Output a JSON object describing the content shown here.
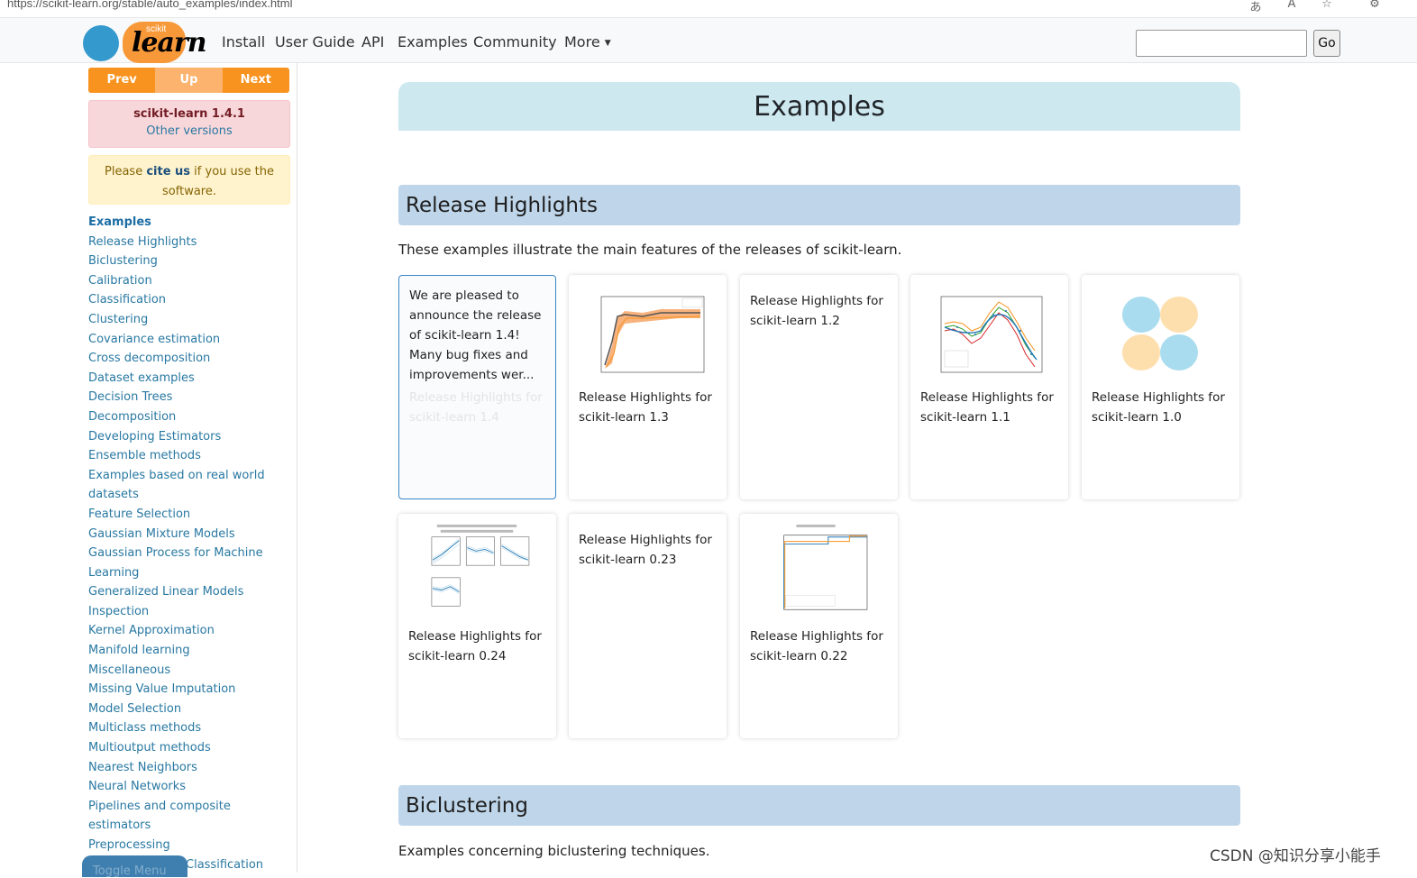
{
  "browser": {
    "url": "https://scikit-learn.org/stable/auto_examples/index.html",
    "icons": [
      "translate-icon",
      "read-aloud-icon",
      "favorite-icon",
      "extensions-icon"
    ]
  },
  "navbar": {
    "logo_small": "scikit",
    "logo_big": "learn",
    "links": [
      "Install",
      "User Guide",
      "API",
      "Examples",
      "Community",
      "More"
    ],
    "search_value": "",
    "go_label": "Go"
  },
  "sidebar": {
    "prev": "Prev",
    "up": "Up",
    "next": "Next",
    "version": "scikit-learn 1.4.1",
    "other_versions": "Other versions",
    "cite_pre": "Please ",
    "cite_link": "cite us",
    "cite_post": " if you use the software.",
    "toc": [
      "Examples",
      "Release Highlights",
      "Biclustering",
      "Calibration",
      "Classification",
      "Clustering",
      "Covariance estimation",
      "Cross decomposition",
      "Dataset examples",
      "Decision Trees",
      "Decomposition",
      "Developing Estimators",
      "Ensemble methods",
      "Examples based on real world",
      "datasets",
      "Feature Selection",
      "Gaussian Mixture Models",
      "Gaussian Process for Machine",
      "Learning",
      "Generalized Linear Models",
      "Inspection",
      "Kernel Approximation",
      "Manifold learning",
      "Miscellaneous",
      "Missing Value Imputation",
      "Model Selection",
      "Multiclass methods",
      "Multioutput methods",
      "Nearest Neighbors",
      "Neural Networks",
      "Pipelines and composite",
      "estimators",
      "Preprocessing"
    ],
    "toc_partial": "Classification",
    "toggle_menu": "Toggle Menu"
  },
  "main": {
    "page_title": "Examples",
    "release": {
      "heading": "Release Highlights",
      "description": "These examples illustrate the main features of the releases of scikit-learn.",
      "hover_tooltip": "We are pleased to announce the release of scikit-learn 1.4! Many bug fixes and improvements wer...",
      "hover_hidden_caption": "Release Highlights for scikit-learn 1.4",
      "cards": [
        "Release Highlights for scikit-learn 1.3",
        "Release Highlights for scikit-learn 1.2",
        "Release Highlights for scikit-learn 1.1",
        "Release Highlights for scikit-learn 1.0",
        "Release Highlights for scikit-learn 0.24",
        "Release Highlights for scikit-learn 0.23",
        "Release Highlights for scikit-learn 0.22"
      ]
    },
    "biclustering": {
      "heading": "Biclustering",
      "description": "Examples concerning biclustering techniques."
    }
  },
  "watermark": "CSDN @知识分享小能手",
  "colors": {
    "prev_next": "#f7931e",
    "up": "#fbb36d",
    "title_bg": "#cde8ef",
    "section_bg": "#bfd6ea",
    "link": "#2878a2"
  }
}
